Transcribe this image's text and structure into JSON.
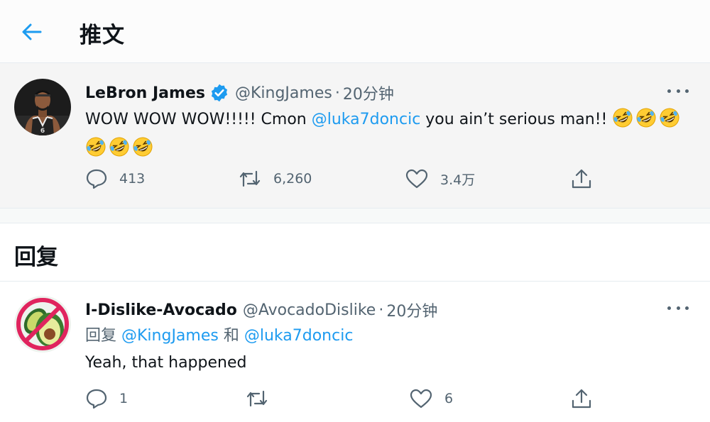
{
  "header": {
    "title": "推文",
    "back_icon": "arrow-left-icon",
    "accent": "#1d9bf0"
  },
  "tweet": {
    "author_name": "LeBron James",
    "verified": true,
    "handle": "@KingJames",
    "separator": "·",
    "time": "20分钟",
    "text_part1": "WOW WOW WOW!!!!! Cmon ",
    "mention": "@luka7doncic",
    "text_part2": " you ain’t serious man!! ",
    "emoji": "rofl-emoji",
    "emoji_count": 6,
    "replies": "413",
    "retweets": "6,260",
    "likes": "3.4万"
  },
  "replies_section": {
    "title": "回复"
  },
  "reply": {
    "author_name": "I-Dislike-Avocado",
    "handle": "@AvocadoDislike",
    "separator": "·",
    "time": "20分钟",
    "reply_to_prefix": "回复 ",
    "reply_to_user1": "@KingJames",
    "reply_to_and": " 和 ",
    "reply_to_user2": "@luka7doncic",
    "text": "Yeah, that happened",
    "replies": "1",
    "retweets": "",
    "likes": "6"
  },
  "colors": {
    "link": "#1d9bf0",
    "secondary_text": "#536471",
    "tweet_bg": "#f5f5f5"
  }
}
